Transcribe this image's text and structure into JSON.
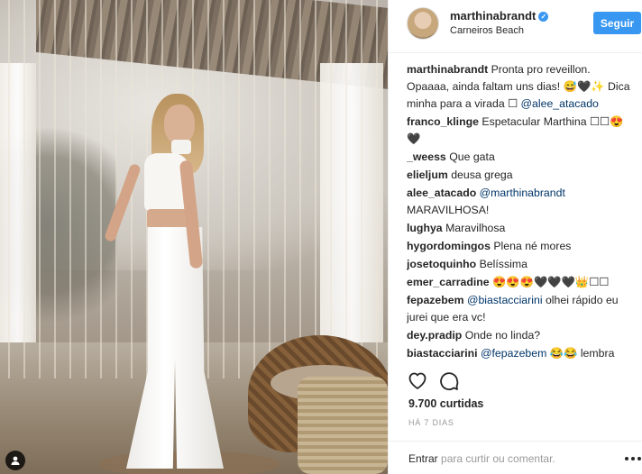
{
  "post": {
    "username": "marthinabrandt",
    "verified": true,
    "location": "Carneiros Beach",
    "follow_label": "Seguir",
    "likes_text": "9.700 curtidas",
    "time_ago": "HÁ 7 DIAS"
  },
  "comments": [
    {
      "user": "marthinabrandt",
      "parts": [
        {
          "text": "Pronta pro reveillon. Opaaaa, ainda faltam uns dias! 😅🖤✨ Dica minha para a virada ☐ "
        },
        {
          "text": "@alee_atacado",
          "mention": true
        }
      ]
    },
    {
      "user": "franco_klinge",
      "parts": [
        {
          "text": "Espetacular Marthina ☐☐😍🖤"
        }
      ]
    },
    {
      "user": "_weess",
      "parts": [
        {
          "text": "Que gata"
        }
      ]
    },
    {
      "user": "elieljum",
      "parts": [
        {
          "text": "deusa grega"
        }
      ]
    },
    {
      "user": "alee_atacado",
      "parts": [
        {
          "text": "@marthinabrandt",
          "mention": true
        },
        {
          "text": " MARAVILHOSA!"
        }
      ]
    },
    {
      "user": "lughya",
      "parts": [
        {
          "text": "Maravilhosa"
        }
      ]
    },
    {
      "user": "hygordomingos",
      "parts": [
        {
          "text": "Plena né mores"
        }
      ]
    },
    {
      "user": "josetoquinho",
      "parts": [
        {
          "text": "Belíssima"
        }
      ]
    },
    {
      "user": "emer_carradine",
      "parts": [
        {
          "text": "😍😍😍🖤🖤🖤👑☐☐"
        }
      ]
    },
    {
      "user": "fepazebem",
      "parts": [
        {
          "text": "@biastacciarini",
          "mention": true
        },
        {
          "text": " olhei rápido eu jurei que era vc!"
        }
      ]
    },
    {
      "user": "dey.pradip",
      "parts": [
        {
          "text": "Onde no linda?"
        }
      ]
    },
    {
      "user": "biastacciarini",
      "parts": [
        {
          "text": "@fepazebem",
          "mention": true
        },
        {
          "text": " 😂😂 lembra"
        }
      ]
    }
  ],
  "comment_bar": {
    "login_link": "Entrar",
    "login_text": " para curtir ou comentar."
  },
  "icons": {
    "like": "heart-outline-icon",
    "comment": "comment-bubble-icon",
    "more": "more-options-icon",
    "tag": "person-tag-icon"
  },
  "colors": {
    "accent": "#3897f0",
    "mention": "#003569",
    "muted": "#999999"
  }
}
